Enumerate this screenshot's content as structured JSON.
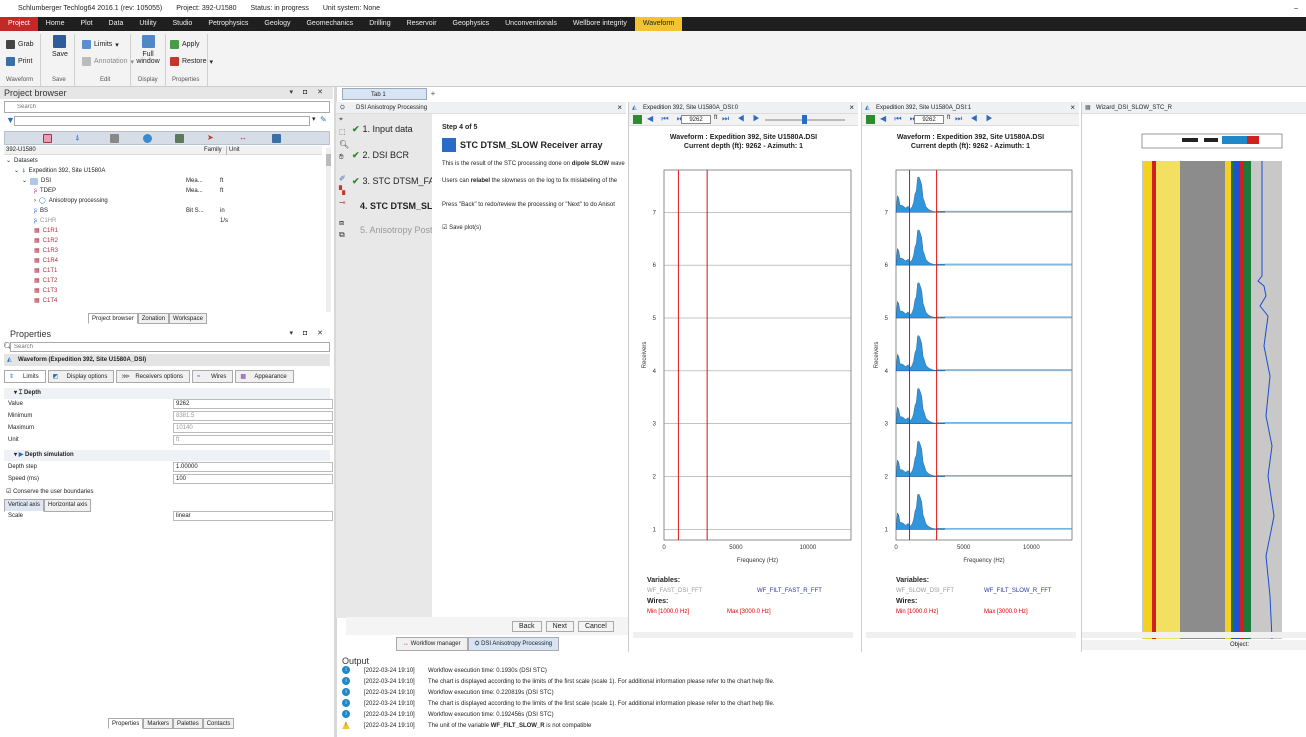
{
  "window": {
    "app_title": "Schlumberger Techlog64 2016.1 (rev: 105055)",
    "project": "Project: 392-U1580",
    "status": "Status: in progress",
    "unit_system": "Unit system: None",
    "minimize": "–"
  },
  "menu": [
    "Project",
    "Home",
    "Plot",
    "Data",
    "Utility",
    "Studio",
    "Petrophysics",
    "Geology",
    "Geomechanics",
    "Drilling",
    "Reservoir",
    "Geophysics",
    "Unconventionals",
    "Wellbore integrity",
    "Waveform"
  ],
  "ribbon": {
    "grab": "Grab",
    "print": "Print",
    "save": "Save",
    "limits": "Limits",
    "annotation": "Annotation",
    "full_window": "Full window",
    "apply": "Apply",
    "restore": "Restore",
    "groups": [
      "Waveform",
      "Save",
      "Edit",
      "Display",
      "Properties"
    ]
  },
  "project_browser": {
    "title": "Project browser",
    "search_placeholder": "Search",
    "col_header": "392-U1580",
    "col_family": "Family",
    "col_unit": "Unit",
    "tree": [
      {
        "label": "Datasets",
        "c2": "",
        "c3": ""
      },
      {
        "label": "Expedition 392, Site U1580A",
        "c2": "",
        "c3": ""
      },
      {
        "label": "DSI",
        "c2": "Mea...",
        "c3": "ft"
      },
      {
        "label": "TDEP",
        "c2": "Mea...",
        "c3": "ft"
      },
      {
        "label": "Anisotropy processing",
        "c2": "",
        "c3": ""
      },
      {
        "label": "BS",
        "c2": "Bit S...",
        "c3": "in"
      },
      {
        "label": "C1HR",
        "c2": "",
        "c3": "1/s"
      },
      {
        "label": "C1R1",
        "c2": "",
        "c3": ""
      },
      {
        "label": "C1R2",
        "c2": "",
        "c3": ""
      },
      {
        "label": "C1R3",
        "c2": "",
        "c3": ""
      },
      {
        "label": "C1R4",
        "c2": "",
        "c3": ""
      },
      {
        "label": "C1T1",
        "c2": "",
        "c3": ""
      },
      {
        "label": "C1T2",
        "c2": "",
        "c3": ""
      },
      {
        "label": "C1T3",
        "c2": "",
        "c3": ""
      },
      {
        "label": "C1T4",
        "c2": "",
        "c3": ""
      }
    ],
    "tabs": [
      "Project browser",
      "Zonation",
      "Workspace"
    ]
  },
  "properties": {
    "title": "Properties",
    "search_placeholder": "Search",
    "object": "Waveform (Expedition 392, Site U1580A_DSI)",
    "tabs": [
      "Limits",
      "Display options",
      "Receivers options",
      "Wires",
      "Appearance"
    ],
    "depth_group": "Depth",
    "value_label": "Value",
    "value": "9262",
    "minimum_label": "Minimum",
    "minimum": "8381.5",
    "maximum_label": "Maximum",
    "maximum": "10140",
    "unit_label": "Unit",
    "unit": "ft",
    "sim_group": "Depth simulation",
    "depth_step_label": "Depth step",
    "depth_step": "1.00000",
    "speed_label": "Speed (ms)",
    "speed": "100",
    "conserve": "Conserve the user boundaries",
    "axis_tabs": [
      "Vertical axis",
      "Horizontal axis"
    ],
    "scale_label": "Scale",
    "scale": "linear",
    "bottom_tabs": [
      "Properties",
      "Markers",
      "Palettes",
      "Contacts"
    ]
  },
  "center": {
    "tab1": "Tab 1",
    "tab_plus": "+",
    "wizard_title": "DSI Anisotropy Processing",
    "steps": [
      "1. Input data",
      "2. DSI BCR",
      "3. STC DTSM_FAST",
      "4. STC DTSM_SLOW",
      "5. Anisotropy Post P"
    ],
    "step_of": "Step 4 of 5",
    "heading": "STC DTSM_SLOW Receiver array",
    "para1a": "This is the result of the STC processing done on ",
    "para1b": "dipole SLOW",
    "para1c": " wave",
    "para2a": "Users can ",
    "para2b": "relabel",
    "para2c": " the slowness on the log to fix mislabeling of the",
    "para3": "Press \"Back\" to redo/review the processing or \"Next\" to do Anisot",
    "save_plots": "Save plot(s)",
    "back": "Back",
    "next": "Next",
    "cancel": "Cancel",
    "bottom_tabs": [
      "Workflow manager",
      "DSI Anisotropy Processing"
    ]
  },
  "panel0": {
    "tab": "Expedition 392, Site U1580A_DSI:0",
    "depth": "9262",
    "unit": "ft",
    "title": "Waveform : Expedition 392, Site U1580A.DSI",
    "subtitle": "Current depth (ft): 9262 - Azimuth: 1",
    "vars_label": "Variables:",
    "var1": "WF_FAST_DSI_FFT",
    "var2": "WF_FILT_FAST_R_FFT",
    "wires_label": "Wires:",
    "wire_min": "Min [1000.0 Hz]",
    "wire_max": "Max [3000.0 Hz]"
  },
  "panel1": {
    "tab": "Expedition 392, Site U1580A_DSI:1",
    "depth": "9262",
    "unit": "ft",
    "title": "Waveform : Expedition 392, Site U1580A.DSI",
    "subtitle": "Current depth (ft): 9262 - Azimuth: 1",
    "vars_label": "Variables:",
    "var1": "WF_SLOW_DSI_FFT",
    "var2": "WF_FILT_SLOW_R_FFT",
    "wires_label": "Wires:",
    "wire_min": "Min [1000.0 Hz]",
    "wire_max": "Max [3000.0 Hz]"
  },
  "panel2": {
    "tab": "Wizard_DSI_SLOW_STC_R",
    "object_label": "Object:"
  },
  "chart_data": [
    {
      "type": "line",
      "xlabel": "Frequency (Hz)",
      "ylabel": "Receivers",
      "xticks": [
        0,
        5000,
        10000
      ],
      "yticks": [
        1,
        2,
        3,
        4,
        5,
        6,
        7
      ],
      "xlim": [
        0,
        13000
      ],
      "ylim": [
        0.8,
        7.8
      ],
      "wires_hz": [
        1000,
        3000
      ],
      "traces": "empty"
    },
    {
      "type": "area",
      "xlabel": "Frequency (Hz)",
      "ylabel": "Receivers",
      "xticks": [
        0,
        5000,
        10000
      ],
      "yticks": [
        1,
        2,
        3,
        4,
        5,
        6,
        7
      ],
      "xlim": [
        0,
        13000
      ],
      "ylim": [
        0.8,
        7.8
      ],
      "wires_hz": [
        1000,
        3000
      ],
      "receivers": [
        1,
        2,
        3,
        4,
        5,
        6,
        7,
        8
      ]
    }
  ],
  "output": {
    "title": "Output",
    "logs": [
      {
        "icon": "info",
        "time": "[2022-03-24 19:10]",
        "text": "Workflow execution time: 0.1930s (DSI STC)"
      },
      {
        "icon": "info",
        "time": "[2022-03-24 19:10]",
        "text": "The chart is displayed according to the limits of the first scale (scale 1). For additional information please refer to the chart help file."
      },
      {
        "icon": "info",
        "time": "[2022-03-24 19:10]",
        "text": "Workflow execution time: 0.220819s (DSI STC)"
      },
      {
        "icon": "info",
        "time": "[2022-03-24 19:10]",
        "text": "The chart is displayed according to the limits of the first scale (scale 1). For additional information please refer to the chart help file."
      },
      {
        "icon": "info",
        "time": "[2022-03-24 19:10]",
        "text": "Workflow execution time: 0.192456s (DSI STC)"
      },
      {
        "icon": "warn",
        "time": "[2022-03-24 19:10]",
        "text": "The unit of the variable WF_FILT_SLOW_R is not compatible"
      }
    ]
  }
}
